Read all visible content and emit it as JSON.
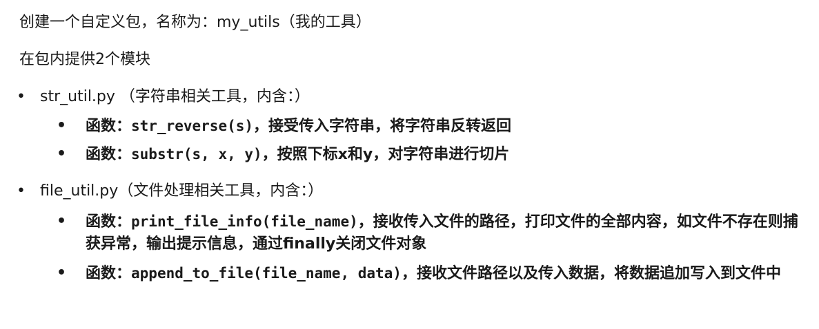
{
  "intro": {
    "line1": "创建一个自定义包，名称为：my_utils（我的工具）",
    "line2": "在包内提供2个模块"
  },
  "modules": [
    {
      "bullet": "•",
      "title": "str_util.py （字符串相关工具，内含：）",
      "functions": [
        {
          "bullet": "•",
          "prefix": "函数：",
          "code": "str_reverse(s)",
          "desc": "，接受传入字符串，将字符串反转返回"
        },
        {
          "bullet": "•",
          "prefix": "函数：",
          "code": "substr(s, x, y)",
          "desc": "，按照下标x和y，对字符串进行切片"
        }
      ]
    },
    {
      "bullet": "•",
      "title": "file_util.py（文件处理相关工具，内含：）",
      "functions": [
        {
          "bullet": "•",
          "prefix": "函数：",
          "code": "print_file_info(file_name)",
          "desc": "，接收传入文件的路径，打印文件的全部内容，如文件不存在则捕获异常，输出提示信息，通过finally关闭文件对象"
        },
        {
          "bullet": "•",
          "prefix": "函数：",
          "code": "append_to_file(file_name, data)",
          "desc": "，接收文件路径以及传入数据，将数据追加写入到文件中"
        }
      ]
    }
  ]
}
